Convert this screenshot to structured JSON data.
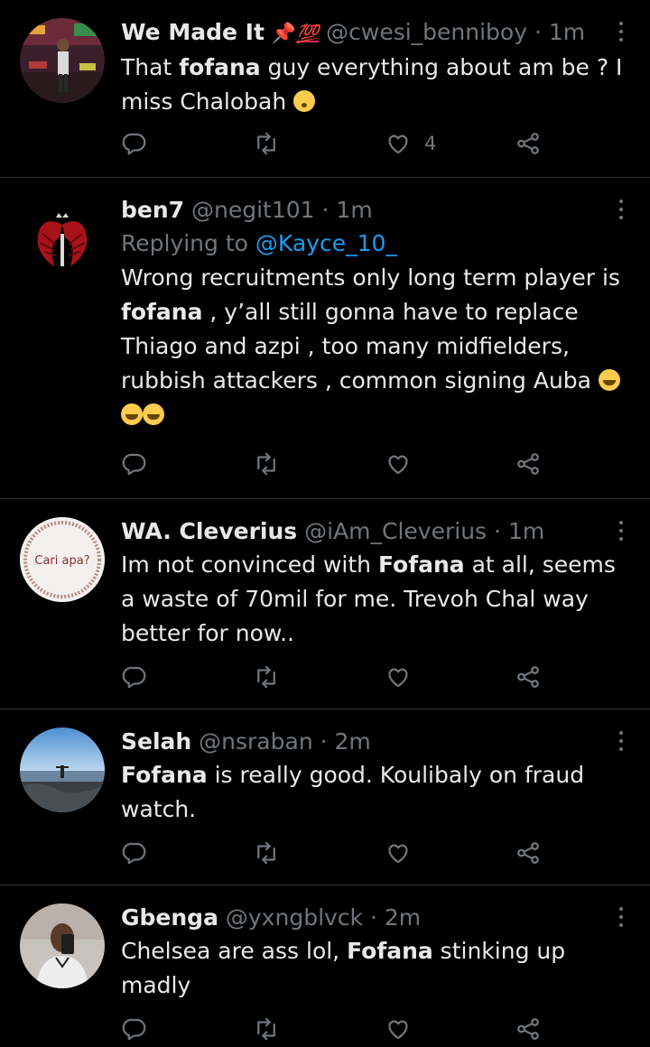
{
  "tweets": [
    {
      "name": "We Made It",
      "name_emoji_1": "📌",
      "name_emoji_2": "💯",
      "handle": "@cwesi_benniboy",
      "separator": "·",
      "time": "1m",
      "body": [
        {
          "text": "That ",
          "bold": false
        },
        {
          "text": "fofana",
          "bold": true
        },
        {
          "text": " guy everything about am be ? I miss Chalobah ",
          "bold": false
        }
      ],
      "likes": "4"
    },
    {
      "name": "ben7",
      "handle": "@negit101",
      "separator": "·",
      "time": "1m",
      "replying_prefix": "Replying to",
      "replying_to": "@Kayce_10_",
      "body": [
        {
          "text": "Wrong recruitments only long term player is ",
          "bold": false
        },
        {
          "text": "fofana",
          "bold": true
        },
        {
          "text": " , y’all still gonna have to replace Thiago and azpi , too many midfielders, rubbish attackers , common signing Auba ",
          "bold": false
        }
      ]
    },
    {
      "name": "WA. Cleverius",
      "handle": "@iAm_Cleverius",
      "separator": "·",
      "time": "1m",
      "avatar_text": "Cari apa?",
      "body": [
        {
          "text": "Im not convinced with ",
          "bold": false
        },
        {
          "text": "Fofana",
          "bold": true
        },
        {
          "text": " at all, seems a waste of 70mil for me. Trevoh Chal way better for now..",
          "bold": false
        }
      ]
    },
    {
      "name": "Selah",
      "handle": "@nsraban",
      "separator": "·",
      "time": "2m",
      "body": [
        {
          "text": "Fofana",
          "bold": true
        },
        {
          "text": " is really good. Koulibaly on fraud watch.",
          "bold": false
        }
      ]
    },
    {
      "name": "Gbenga",
      "handle": "@yxngblvck",
      "separator": "·",
      "time": "2m",
      "body": [
        {
          "text": "Chelsea are ass lol, ",
          "bold": false
        },
        {
          "text": "Fofana",
          "bold": true
        },
        {
          "text": " stinking up madly",
          "bold": false
        }
      ]
    }
  ],
  "colors": {
    "background": "#000000",
    "text": "#e7e9ea",
    "muted": "#71767b",
    "link": "#1d9bf0",
    "divider": "#2f3336"
  },
  "icons": [
    "reply-icon",
    "retweet-icon",
    "like-icon",
    "share-icon",
    "more-icon"
  ]
}
